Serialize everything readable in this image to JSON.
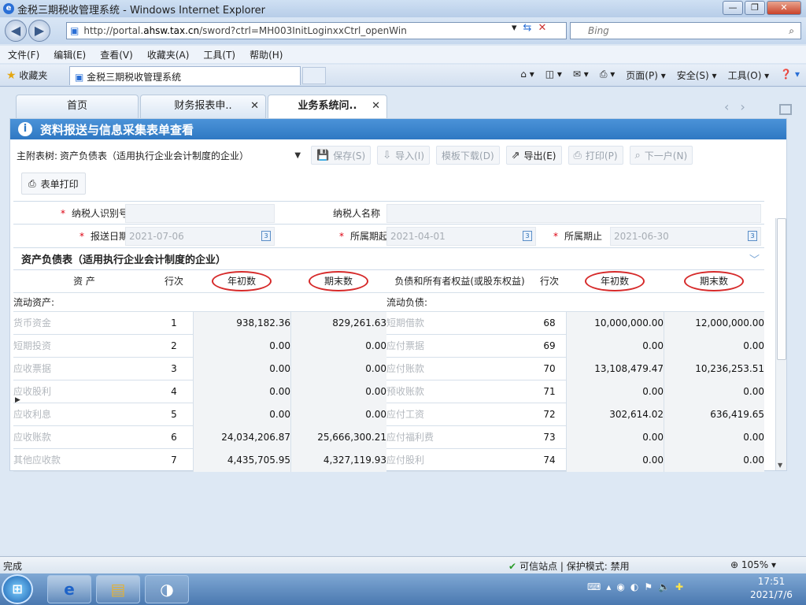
{
  "window": {
    "title": "金税三期税收管理系统 - Windows Internet Explorer"
  },
  "address": {
    "url_prefix": "http://portal.",
    "domain": "ahsw.tax.cn",
    "url_rest": "/sword?ctrl=MH003InitLoginxxCtrl_openWin",
    "search_placeholder": "Bing"
  },
  "menu": [
    "文件(F)",
    "编辑(E)",
    "查看(V)",
    "收藏夹(A)",
    "工具(T)",
    "帮助(H)"
  ],
  "favorites": {
    "label": "收藏夹",
    "tab_title": "金税三期税收管理系统"
  },
  "command_bar": {
    "page": "页面(P) ▾",
    "safety": "安全(S) ▾",
    "tools": "工具(O) ▾"
  },
  "app_tabs": [
    {
      "label": "首页"
    },
    {
      "label": "财务报表申..",
      "close": "✕"
    },
    {
      "label": "业务系统问..",
      "close": "✕"
    }
  ],
  "panel": {
    "title": "资料报送与信息采集表单查看"
  },
  "toolbar": {
    "tree_label": "主附表树:",
    "tree_value": "资产负债表（适用执行企业会计制度的企业）",
    "save": "保存(S)",
    "import": "导入(I)",
    "template": "模板下载(D)",
    "export": "导出(E)",
    "print": "打印(P)",
    "next": "下一户(N)",
    "form_print": "表单打印"
  },
  "header_fields": {
    "taxpayer_id_label": "纳税人识别号",
    "taxpayer_name_label": "纳税人名称",
    "submit_date_label": "报送日期",
    "submit_date": "2021-07-06",
    "period_start_label": "所属期起",
    "period_start": "2021-04-01",
    "period_end_label": "所属期止",
    "period_end": "2021-06-30",
    "required_mark": "*"
  },
  "sheet": {
    "title": "资产负债表（适用执行企业会计制度的企业）"
  },
  "grid": {
    "headers": {
      "assets": "资 产",
      "row": "行次",
      "begin": "年初数",
      "end": "期末数",
      "liabilities": "负债和所有者权益(或股东权益)",
      "row2": "行次",
      "begin2": "年初数",
      "end2": "期末数"
    },
    "section_left": "流动资产:",
    "section_right": "流动负债:",
    "rows": [
      {
        "a_name": "货币资金",
        "a_row": "1",
        "a_begin": "938,182.36",
        "a_end": "829,261.63",
        "l_name": "短期借款",
        "l_row": "68",
        "l_begin": "10,000,000.00",
        "l_end": "12,000,000.00"
      },
      {
        "a_name": "短期投资",
        "a_row": "2",
        "a_begin": "0.00",
        "a_end": "0.00",
        "l_name": "应付票据",
        "l_row": "69",
        "l_begin": "0.00",
        "l_end": "0.00"
      },
      {
        "a_name": "应收票据",
        "a_row": "3",
        "a_begin": "0.00",
        "a_end": "0.00",
        "l_name": "应付账款",
        "l_row": "70",
        "l_begin": "13,108,479.47",
        "l_end": "10,236,253.51"
      },
      {
        "a_name": "应收股利",
        "a_row": "4",
        "a_begin": "0.00",
        "a_end": "0.00",
        "l_name": "预收账款",
        "l_row": "71",
        "l_begin": "0.00",
        "l_end": "0.00"
      },
      {
        "a_name": "应收利息",
        "a_row": "5",
        "a_begin": "0.00",
        "a_end": "0.00",
        "l_name": "应付工资",
        "l_row": "72",
        "l_begin": "302,614.02",
        "l_end": "636,419.65"
      },
      {
        "a_name": "应收账款",
        "a_row": "6",
        "a_begin": "24,034,206.87",
        "a_end": "25,666,300.21",
        "l_name": "应付福利费",
        "l_row": "73",
        "l_begin": "0.00",
        "l_end": "0.00"
      },
      {
        "a_name": "其他应收款",
        "a_row": "7",
        "a_begin": "4,435,705.95",
        "a_end": "4,327,119.93",
        "l_name": "应付股利",
        "l_row": "74",
        "l_begin": "0.00",
        "l_end": "0.00"
      }
    ]
  },
  "status": {
    "text": "完成",
    "zone": "可信站点 | 保护模式: 禁用",
    "zoom": "105%"
  },
  "clock": {
    "time": "17:51",
    "date": "2021/7/6"
  },
  "colors": {
    "accent": "#2f78c3",
    "oval": "#d62a2a"
  }
}
